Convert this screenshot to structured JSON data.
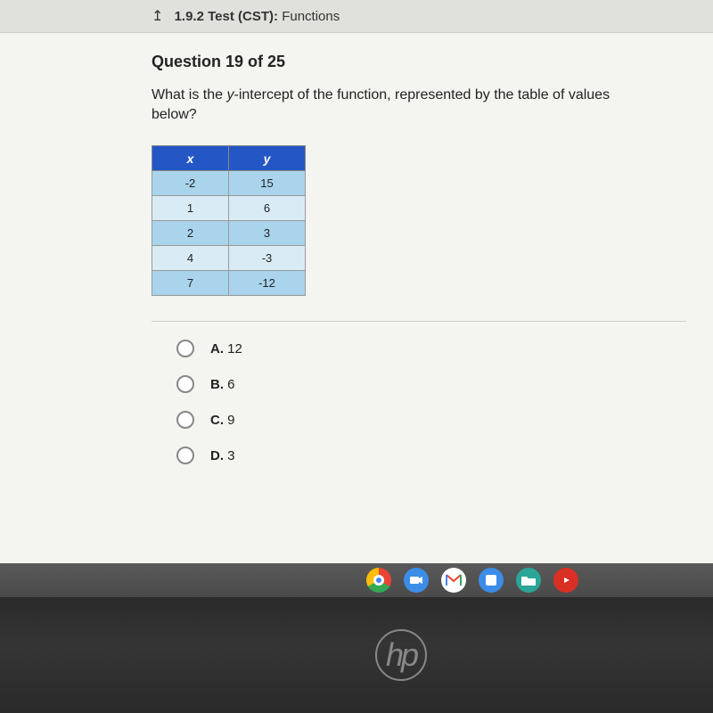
{
  "header": {
    "back_icon": "↥",
    "test_id": "1.9.2",
    "test_label": "Test (CST):",
    "test_name": "Functions"
  },
  "question": {
    "number_label": "Question 19 of 25",
    "prompt_pre": "What is the ",
    "prompt_var": "y",
    "prompt_post": "-intercept of the function, represented by the table of values below?"
  },
  "table": {
    "headers": {
      "x": "x",
      "y": "y"
    },
    "rows": [
      {
        "x": "-2",
        "y": "15"
      },
      {
        "x": "1",
        "y": "6"
      },
      {
        "x": "2",
        "y": "3"
      },
      {
        "x": "4",
        "y": "-3"
      },
      {
        "x": "7",
        "y": "-12"
      }
    ]
  },
  "options": [
    {
      "letter": "A.",
      "value": "12"
    },
    {
      "letter": "B.",
      "value": "6"
    },
    {
      "letter": "C.",
      "value": "9"
    },
    {
      "letter": "D.",
      "value": "3"
    }
  ],
  "taskbar": {
    "chrome": "chrome",
    "camera": "camera",
    "gmail": "gmail",
    "app1": "app",
    "files": "files",
    "youtube": "youtube"
  },
  "laptop": {
    "brand": "hp"
  }
}
